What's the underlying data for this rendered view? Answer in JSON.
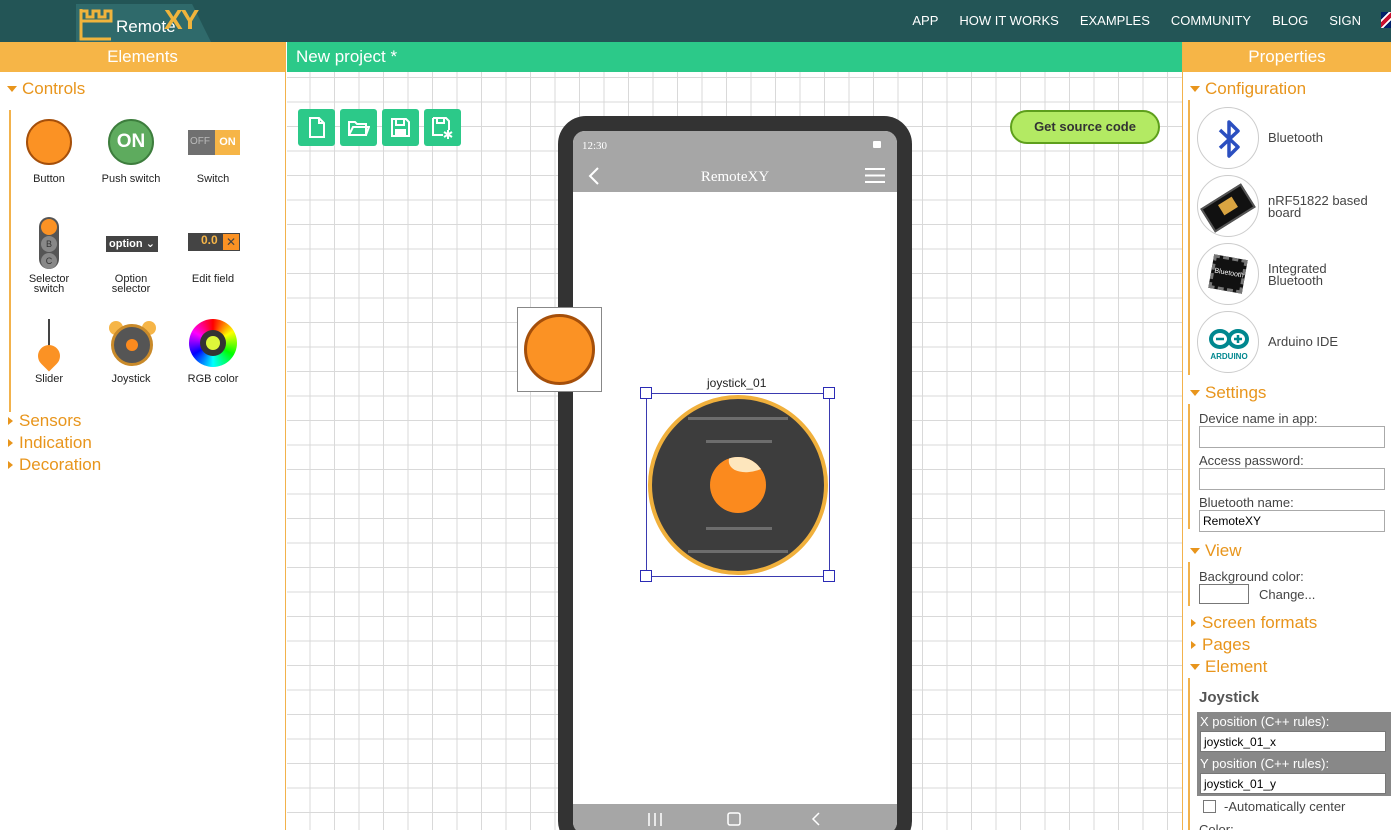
{
  "header": {
    "logo_text": "Remote",
    "logo_xy": "XY",
    "nav": [
      "APP",
      "HOW IT WORKS",
      "EXAMPLES",
      "COMMUNITY",
      "BLOG",
      "SIGN"
    ]
  },
  "left": {
    "title": "Elements",
    "sections": {
      "controls": "Controls",
      "sensors": "Sensors",
      "indication": "Indication",
      "decoration": "Decoration"
    },
    "elements": [
      {
        "label": "Button"
      },
      {
        "label": "Push switch"
      },
      {
        "label": "Switch"
      },
      {
        "label": "Selector\nswitch"
      },
      {
        "label": "Option\nselector"
      },
      {
        "label": "Edit field"
      },
      {
        "label": "Slider"
      },
      {
        "label": "Joystick"
      },
      {
        "label": "RGB color"
      }
    ],
    "icon_text": {
      "push_on": "ON",
      "switch_off": "OFF",
      "switch_on": "ON",
      "option": "option",
      "edit_value": "0.0",
      "edit_clear": "✕",
      "sel_b": "B",
      "sel_c": "C"
    }
  },
  "center": {
    "project_title": "New project *",
    "source_button": "Get source code",
    "phone": {
      "time": "12:30",
      "app_title": "RemoteXY"
    },
    "joystick_label": "joystick_01"
  },
  "right": {
    "title": "Properties",
    "sections": {
      "configuration": "Configuration",
      "settings": "Settings",
      "view": "View",
      "screen_formats": "Screen formats",
      "pages": "Pages",
      "element": "Element"
    },
    "config_options": [
      {
        "label": "Bluetooth",
        "icon": "bluetooth-icon"
      },
      {
        "label": "nRF51822 based\nboard",
        "icon": "nrf-board-icon"
      },
      {
        "label": "Integrated\nBluetooth",
        "icon": "integrated-bluetooth-icon"
      },
      {
        "label": "Arduino IDE",
        "icon": "arduino-icon"
      }
    ],
    "config_icon_text": {
      "integrated": "Bluetooth",
      "arduino": "ARDUINO"
    },
    "settings": {
      "device_name_label": "Device name in app:",
      "device_name_value": "",
      "password_label": "Access password:",
      "password_value": "",
      "bt_name_label": "Bluetooth name:",
      "bt_name_value": "RemoteXY"
    },
    "view": {
      "bg_label": "Background color:",
      "change": "Change..."
    },
    "element": {
      "name": "Joystick",
      "x_label": "X position (C++ rules):",
      "x_value": "joystick_01_x",
      "y_label": "Y position (C++ rules):",
      "y_value": "joystick_01_y",
      "auto_center": "-Automatically center",
      "auto_center_checked": false,
      "color_label": "Color:"
    }
  },
  "colors": {
    "topbar": "#235556",
    "orange_panel": "#f6b547",
    "green_panel": "#2cc989",
    "accent_text": "#e8951c",
    "button_orange": "#fb9224"
  }
}
